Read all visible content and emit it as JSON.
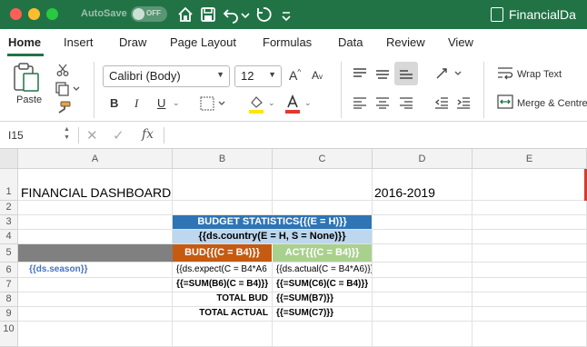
{
  "titlebar": {
    "autosave_label": "AutoSave",
    "toggle_state": "OFF",
    "doc_name": "FinancialDa"
  },
  "tabs": [
    "Home",
    "Insert",
    "Draw",
    "Page Layout",
    "Formulas",
    "Data",
    "Review",
    "View"
  ],
  "ribbon": {
    "paste_label": "Paste",
    "font_name": "Calibri (Body)",
    "font_size": "12",
    "bold": "B",
    "italic": "I",
    "underline": "U",
    "grow_font": "A",
    "shrink_font": "A",
    "wrap_text": "Wrap Text",
    "merge_centre": "Merge & Centre",
    "font_color": "#e03a2f",
    "highlight_color": "#ffe600"
  },
  "formula_bar": {
    "name_box": "I15",
    "fx": "fx",
    "formula": ""
  },
  "columns": [
    "A",
    "B",
    "C",
    "D",
    "E"
  ],
  "rows": [
    "1",
    "2",
    "3",
    "4",
    "5",
    "6",
    "7",
    "8",
    "9",
    "10"
  ],
  "cells": {
    "A1": "FINANCIAL DASHBOARD",
    "D1": "2016-2019",
    "B3": "BUDGET STATISTICS{{(E = H)}}",
    "B4": "{{ds.country(E = H, S = None)}}",
    "B5": "BUD{{(C = B4)}}",
    "C5": "ACT{{(C = B4)}}",
    "A6": "{{ds.season}}",
    "B6": "{{ds.expect(C = B4*A6",
    "C6": "{{ds.actual(C = B4*A6)}}",
    "B7": "{{=SUM(B6)(C = B4)}}",
    "C7": "{{=SUM(C6)(C = B4)}}",
    "B8": "TOTAL BUD",
    "C8": "{{=SUM(B7)}}",
    "B9": "TOTAL ACTUAL",
    "C9": "{{=SUM(C7)}}"
  },
  "colors": {
    "excel_green": "#217346",
    "header_blue": "#2e75b6",
    "country_blue": "#bdd7ee",
    "bud_orange": "#c55a11",
    "act_green": "#a9d18e",
    "grey_fill": "#808080",
    "season_blue": "#4472c4"
  }
}
